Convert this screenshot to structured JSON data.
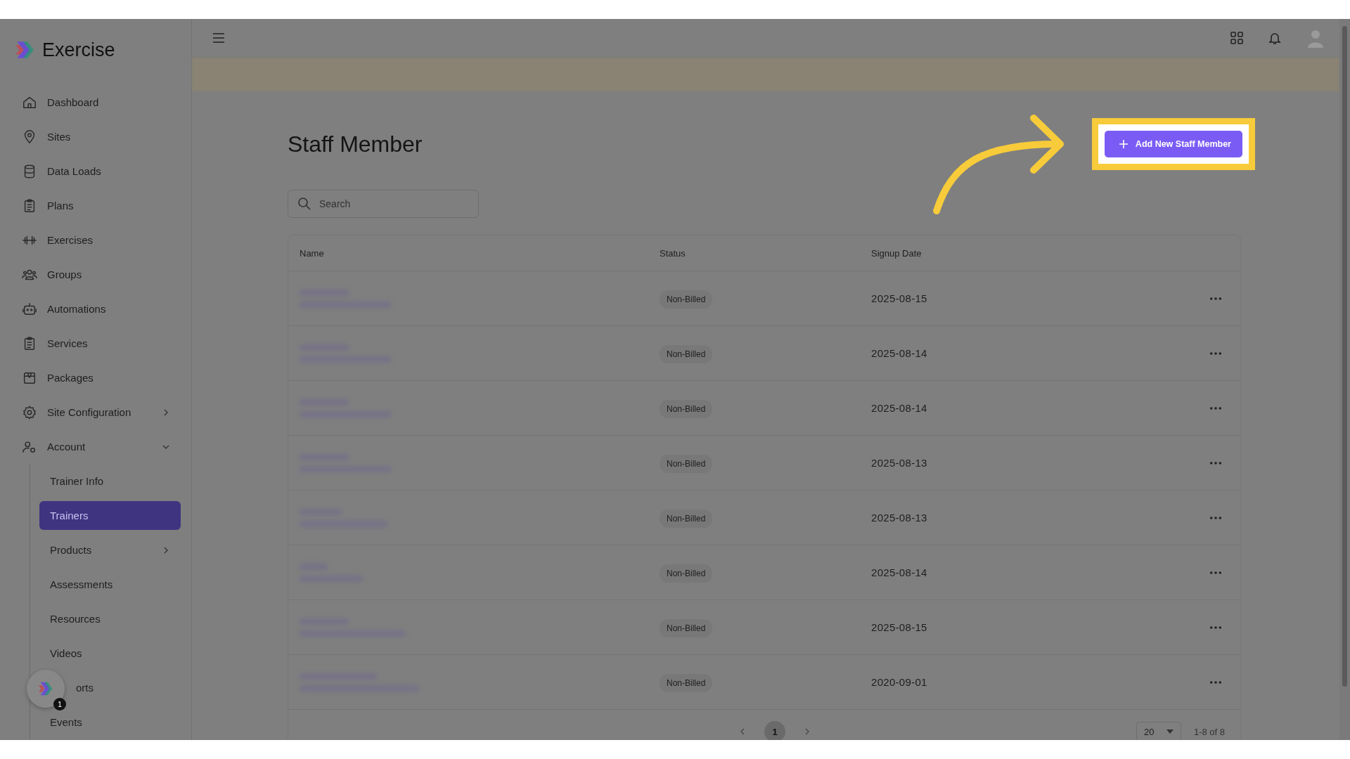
{
  "sidebar": {
    "logo": "Exercise",
    "items": [
      {
        "label": "Dashboard",
        "selected": false
      },
      {
        "label": "Sites",
        "selected": false
      },
      {
        "label": "Data Loads",
        "selected": false
      },
      {
        "label": "Plans",
        "selected": false
      },
      {
        "label": "Exercises",
        "selected": false
      },
      {
        "label": "Groups",
        "selected": false
      },
      {
        "label": "Automations",
        "selected": false
      },
      {
        "label": "Services",
        "selected": false
      },
      {
        "label": "Packages",
        "selected": false
      },
      {
        "label": "Site Configuration",
        "selected": false,
        "expanded": false
      },
      {
        "label": "Account",
        "selected": false,
        "expanded": true,
        "children": [
          {
            "label": "Trainer Info",
            "selected": false
          },
          {
            "label": "Trainers",
            "selected": true
          },
          {
            "label": "Products",
            "selected": false,
            "expanded": false
          },
          {
            "label": "Assessments",
            "selected": false
          },
          {
            "label": "Resources",
            "selected": false
          },
          {
            "label": "Videos",
            "selected": false
          },
          {
            "label": "orts",
            "selected": false
          },
          {
            "label": "Events",
            "selected": false
          }
        ]
      }
    ]
  },
  "chat_widget": {
    "badge": "1"
  },
  "page": {
    "title": "Staff Member",
    "add_button": "Add New Staff Member",
    "search": {
      "placeholder": "Search"
    }
  },
  "table": {
    "columns": [
      "Name",
      "Status",
      "Signup Date"
    ],
    "rows": [
      {
        "status": "Non-Billed",
        "signup_date": "2025-08-15"
      },
      {
        "status": "Non-Billed",
        "signup_date": "2025-08-14"
      },
      {
        "status": "Non-Billed",
        "signup_date": "2025-08-14"
      },
      {
        "status": "Non-Billed",
        "signup_date": "2025-08-13"
      },
      {
        "status": "Non-Billed",
        "signup_date": "2025-08-13"
      },
      {
        "status": "Non-Billed",
        "signup_date": "2025-08-14"
      },
      {
        "status": "Non-Billed",
        "signup_date": "2025-08-15"
      },
      {
        "status": "Non-Billed",
        "signup_date": "2020-09-01"
      }
    ]
  },
  "pagination": {
    "pages": [
      {
        "label": "1",
        "selected": true
      }
    ],
    "page_size": "20",
    "range": "1-8 of 8"
  }
}
